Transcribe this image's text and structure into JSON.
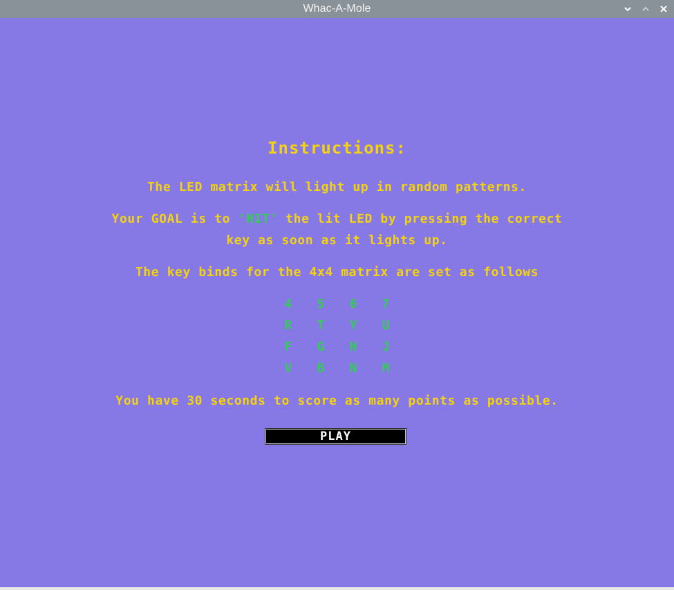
{
  "window": {
    "title": "Whac-A-Mole",
    "controls": [
      "minimize-icon",
      "maximize-icon",
      "close-icon"
    ]
  },
  "colors": {
    "background": "#8679e6",
    "text_yellow": "#f5d20f",
    "text_green": "#33cc55",
    "titlebar": "#8a9299",
    "button_bg": "#000000",
    "button_text": "#ffffff"
  },
  "instructions": {
    "heading": "Instructions:",
    "line1": "The LED matrix will light up in random patterns.",
    "line2_prefix": "Your GOAL is to ",
    "line2_hit": "'HIT'",
    "line2_suffix": " the lit LED by pressing the correct",
    "line2_cont": "key as soon as it lights up.",
    "line3": "The key binds for the 4x4 matrix are set as follows",
    "line4": "You have 30 seconds to score as many points as possible."
  },
  "keybinds": [
    [
      "4",
      "5",
      "6",
      "7"
    ],
    [
      "R",
      "T",
      "Y",
      "U"
    ],
    [
      "F",
      "G",
      "H",
      "J"
    ],
    [
      "V",
      "B",
      "N",
      "M"
    ]
  ],
  "play_button": {
    "label": "PLAY"
  }
}
